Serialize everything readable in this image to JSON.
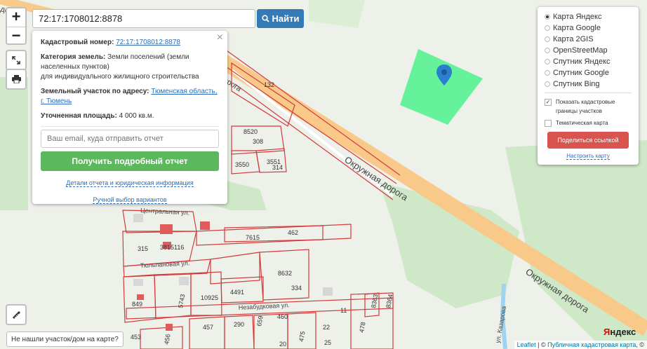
{
  "search": {
    "value": "72:17:1708012:8878",
    "button_label": "Найти"
  },
  "zoom": {
    "in": "+",
    "out": "−"
  },
  "popup": {
    "cadastral_label": "Кадастровый номер:",
    "cadastral_value": "72:17:1708012:8878",
    "category_label": "Категория земель:",
    "category_value": "Земли поселений (земли населенных пунктов)",
    "use_value": "для индивидуального жилищного строительства",
    "address_label": "Земельный участок по адресу:",
    "address_value": "Тюменская область, г. Тюмень",
    "area_label": "Уточненная площадь:",
    "area_value": "4 000 кв.м.",
    "email_placeholder": "Ваш email, куда отправить отчет",
    "report_button": "Получить подробный отчет",
    "details_link": "Детали отчета и юридическая информация",
    "manual_link": "Ручной выбор вариантов"
  },
  "layers": {
    "options": [
      {
        "label": "Карта Яндекс",
        "selected": true
      },
      {
        "label": "Карта Google",
        "selected": false
      },
      {
        "label": "Карта 2GIS",
        "selected": false
      },
      {
        "label": "OpenStreetMap",
        "selected": false
      },
      {
        "label": "Спутник Яндекс",
        "selected": false
      },
      {
        "label": "Спутник Google",
        "selected": false
      },
      {
        "label": "Спутник Bing",
        "selected": false
      }
    ],
    "show_boundaries": "Показать кадастровые границы участков",
    "thematic_map": "Тематическая карта",
    "share_button": "Поделиться ссылкой",
    "setup_link": "Настроить карту"
  },
  "not_found": "Не нашли участок/дом на карте?",
  "map_labels": {
    "road_top": "дорога",
    "road_top_left": "дорога",
    "ring_road_1": "Окружная дорога",
    "ring_road_2": "Окружная дорога",
    "street_central": "Центральная ул.",
    "street_tulip": "Тюльпановая ул.",
    "street_nezabudka": "Незабудковая ул.",
    "street_kazarova": "ул. Казарова",
    "yandex_logo_red": "Я",
    "yandex_logo_black": "ндекс"
  },
  "parcels": [
    "132",
    "8520",
    "308",
    "3550",
    "3551",
    "314",
    "315",
    "3815",
    "116",
    "7615",
    "462",
    "8632",
    "334",
    "849",
    "5743",
    "10925",
    "4491",
    "457",
    "290",
    "659",
    "460",
    "11",
    "8363",
    "8364",
    "478",
    "453",
    "456",
    "475",
    "22",
    "25",
    "20"
  ],
  "attribution": {
    "leaflet": "Leaflet",
    "sep": " | © ",
    "pkk": "Публичная кадастровая карта",
    "tail": ", ©"
  },
  "colors": {
    "parcel_highlight": "#66f29a",
    "marker": "#2c7fcf",
    "boundary": "#d23b3b",
    "road": "#f9c98a",
    "green": "#cfe8c7"
  }
}
